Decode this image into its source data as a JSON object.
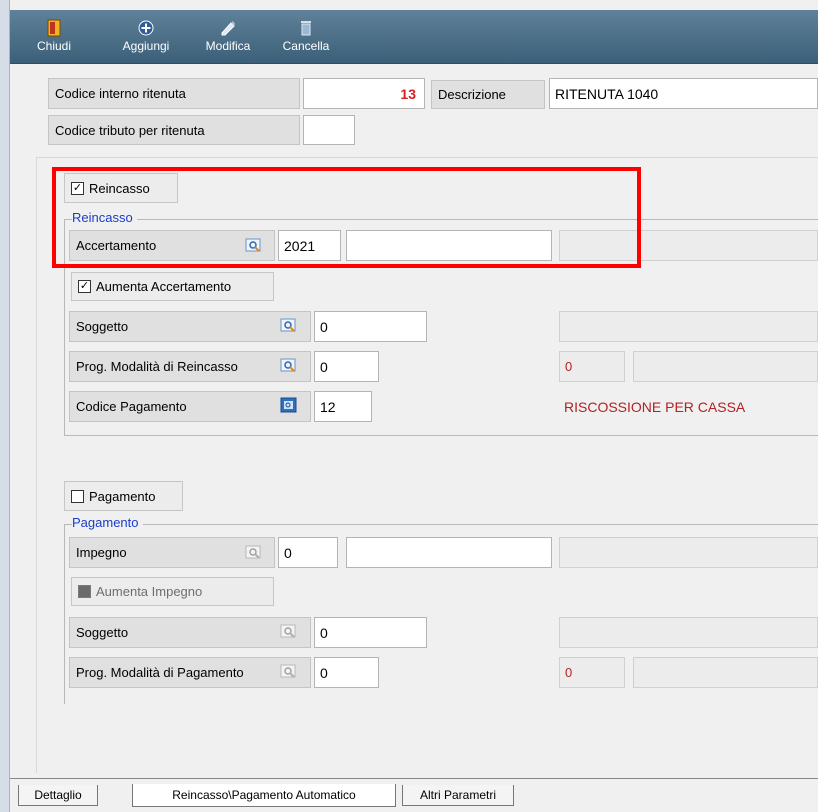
{
  "toolbar": {
    "buttons": [
      {
        "label": "Chiudi",
        "icon": "door-icon"
      },
      {
        "label": "Aggiungi",
        "icon": "plus-icon"
      },
      {
        "label": "Modifica",
        "icon": "pencil-icon"
      },
      {
        "label": "Cancella",
        "icon": "trash-icon"
      }
    ]
  },
  "header": {
    "codice_interno_label": "Codice interno ritenuta",
    "codice_interno_value": "13",
    "descrizione_label": "Descrizione",
    "descrizione_value": "RITENUTA 1040",
    "codice_tributo_label": "Codice tributo per ritenuta",
    "codice_tributo_value": ""
  },
  "reincasso": {
    "checkbox_label": "Reincasso",
    "checked": true,
    "group_title": "Reincasso",
    "accertamento_label": "Accertamento",
    "accertamento_anno": "2021",
    "accertamento_numero": "",
    "aumenta_label": "Aumenta Accertamento",
    "aumenta_checked": true,
    "soggetto_label": "Soggetto",
    "soggetto_value": "0",
    "prog_label": "Prog. Modalità di Reincasso",
    "prog_value": "0",
    "prog_side_value": "0",
    "codice_pag_label": "Codice Pagamento",
    "codice_pag_value": "12",
    "codice_pag_desc": "RISCOSSIONE PER CASSA"
  },
  "pagamento": {
    "checkbox_label": "Pagamento",
    "checked": false,
    "group_title": "Pagamento",
    "impegno_label": "Impegno",
    "impegno_value": "0",
    "impegno_numero": "",
    "aumenta_label": "Aumenta Impegno",
    "soggetto_label": "Soggetto",
    "soggetto_value": "0",
    "prog_label": "Prog. Modalità di Pagamento",
    "prog_value": "0",
    "prog_side_value": "0"
  },
  "tabs": [
    {
      "label": "Dettaglio"
    },
    {
      "label": "Reincasso\\Pagamento Automatico"
    },
    {
      "label": "Altri Parametri"
    }
  ],
  "colors": {
    "highlight": "#ff0000",
    "toolbar": "#4a6d86",
    "legend": "#1a3ccc",
    "value_red": "#b22222"
  }
}
